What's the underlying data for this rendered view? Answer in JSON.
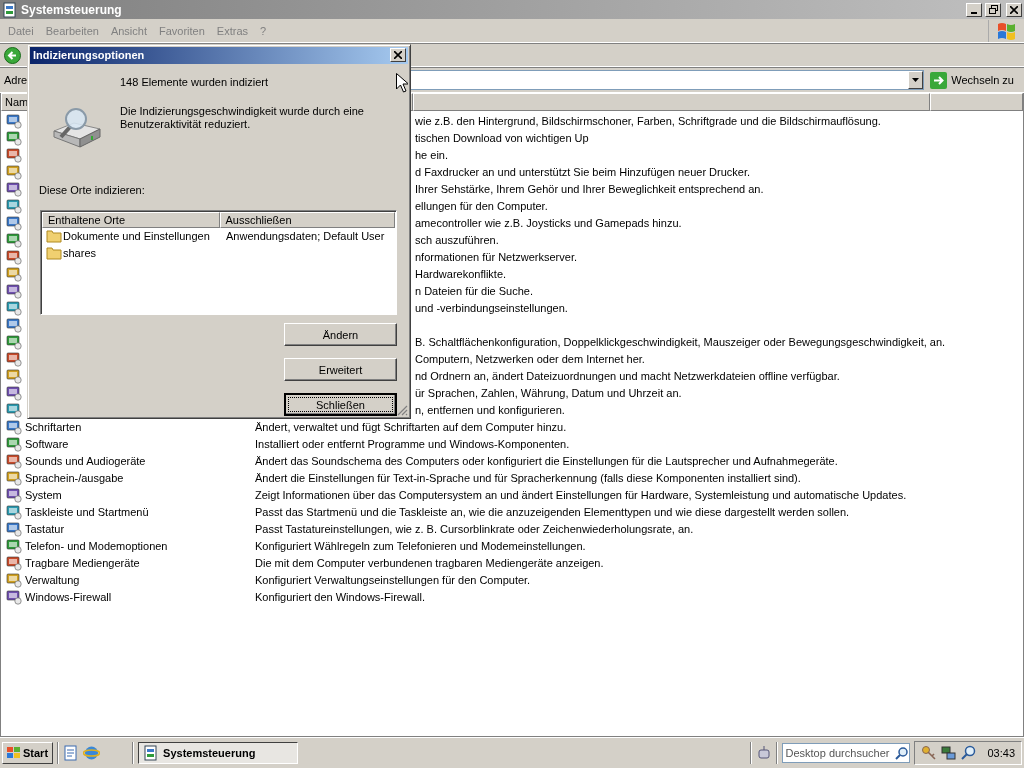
{
  "window": {
    "title": "Systemsteuerung"
  },
  "menu": [
    "Datei",
    "Bearbeiten",
    "Ansicht",
    "Favoriten",
    "Extras",
    "?"
  ],
  "address_bar": {
    "label": "Adre",
    "go_button": "Wechseln zu"
  },
  "list": {
    "columns": [
      "Nam"
    ],
    "rows": [
      {
        "kind": "covered",
        "description": "wie z.B. den Hintergrund, Bildschirmschoner, Farben, Schriftgrade und die Bildschirmauflösung."
      },
      {
        "kind": "covered",
        "description": "tischen Download von wichtigen Up"
      },
      {
        "kind": "covered",
        "description": "he ein."
      },
      {
        "kind": "covered",
        "description": "d Faxdrucker an und unterstützt Sie beim Hinzufügen neuer Drucker."
      },
      {
        "kind": "covered",
        "description": "Ihrer Sehstärke, Ihrem Gehör und Ihrer Beweglichkeit entsprechend an."
      },
      {
        "kind": "covered",
        "description": "ellungen für den Computer."
      },
      {
        "kind": "covered",
        "description": "amecontroller wie z.B. Joysticks und Gamepads hinzu."
      },
      {
        "kind": "covered",
        "description": "sch auszuführen."
      },
      {
        "kind": "covered",
        "description": "nformationen für Netzwerkserver."
      },
      {
        "kind": "covered",
        "description": "Hardwarekonflikte."
      },
      {
        "kind": "covered",
        "description": "n Dateien für die Suche."
      },
      {
        "kind": "covered",
        "description": "und -verbindungseinstellungen."
      },
      {
        "kind": "covered"
      },
      {
        "kind": "covered",
        "description": "B. Schaltflächenkonfiguration, Doppelklickgeschwindigkeit, Mauszeiger oder Bewegungsgeschwindigkeit, an."
      },
      {
        "kind": "covered",
        "description": "Computern, Netzwerken oder dem Internet her."
      },
      {
        "kind": "covered",
        "description": "nd Ordnern an, ändert Dateizuordnungen und macht Netzwerkdateien offline verfügbar."
      },
      {
        "kind": "covered",
        "description": "ür Sprachen, Zahlen, Währung, Datum und Uhrzeit an."
      },
      {
        "kind": "covered",
        "description": "n, entfernen und konfigurieren."
      },
      {
        "kind": "full",
        "name": "Schriftarten",
        "description": "Ändert, verwaltet und fügt Schriftarten auf dem Computer hinzu."
      },
      {
        "kind": "full",
        "name": "Software",
        "description": "Installiert oder entfernt Programme und Windows-Komponenten."
      },
      {
        "kind": "full",
        "name": "Sounds und Audiogeräte",
        "description": "Ändert das Soundschema des Computers oder konfiguriert die Einstellungen für die Lautsprecher und Aufnahmegeräte."
      },
      {
        "kind": "full",
        "name": "Sprachein-/ausgabe",
        "description": "Ändert die Einstellungen für Text-in-Sprache und für Spracherkennung (falls diese Komponenten installiert sind)."
      },
      {
        "kind": "full",
        "name": "System",
        "description": "Zeigt Informationen über das Computersystem an und ändert Einstellungen für Hardware, Systemleistung und automatische Updates."
      },
      {
        "kind": "full",
        "name": "Taskleiste und Startmenü",
        "description": "Passt das Startmenü und die Taskleiste an, wie die anzuzeigenden Elementtypen und wie diese dargestellt werden sollen."
      },
      {
        "kind": "full",
        "name": "Tastatur",
        "description": "Passt Tastatureinstellungen, wie z. B. Cursorblinkrate oder Zeichenwiederholungsrate, an."
      },
      {
        "kind": "full",
        "name": "Telefon- und Modemoptionen",
        "description": "Konfiguriert Wählregeln zum Telefonieren und Modemeinstellungen."
      },
      {
        "kind": "full",
        "name": "Tragbare Mediengeräte",
        "description": "Die mit dem Computer verbundenen tragbaren Mediengeräte anzeigen."
      },
      {
        "kind": "full",
        "name": "Verwaltung",
        "description": "Konfiguriert Verwaltungseinstellungen für den Computer."
      },
      {
        "kind": "full",
        "name": "Windows-Firewall",
        "description": "Konfiguriert den Windows-Firewall."
      }
    ]
  },
  "dialog": {
    "title": "Indizierungsoptionen",
    "status": "148 Elemente wurden indiziert",
    "message": "Die Indizierungsgeschwindigkeit wurde durch eine Benutzeraktivität reduziert.",
    "locations_label": "Diese Orte indizieren:",
    "locations": {
      "columns": [
        "Enthaltene Orte",
        "Ausschließen"
      ],
      "rows": [
        {
          "location": "Dokumente und Einstellungen",
          "exclude": "Anwendungsdaten; Default User"
        },
        {
          "location": "shares"
        }
      ]
    },
    "buttons": [
      {
        "label": "Ändern",
        "default": false
      },
      {
        "label": "Erweitert",
        "default": false
      },
      {
        "label": "Schließen",
        "default": true
      }
    ]
  },
  "taskbar": {
    "start": "Start",
    "tasks": [
      {
        "label": "Systemsteuerung",
        "selected": true
      }
    ],
    "search": {
      "placeholder": "Desktop durchsucher"
    },
    "clock": "03:43"
  }
}
